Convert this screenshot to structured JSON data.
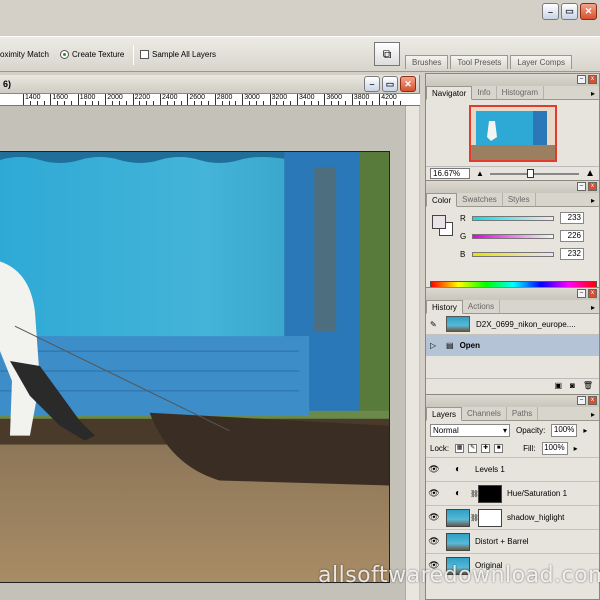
{
  "app": {
    "buttons": [
      "minimize",
      "maximize",
      "close"
    ]
  },
  "options_bar": {
    "proximity_match": "oximity Match",
    "create_texture": "Create Texture",
    "sample_all_layers": "Sample All Layers",
    "well_tabs": [
      "Brushes",
      "Tool Presets",
      "Layer Comps"
    ]
  },
  "document": {
    "title": "6)",
    "ruler": [
      "1400",
      "1600",
      "1800",
      "2000",
      "2200",
      "2400",
      "2600",
      "2800",
      "3000",
      "3200",
      "3400",
      "3600",
      "3800",
      "4200"
    ]
  },
  "navigator": {
    "tabs": [
      "Navigator",
      "Info",
      "Histogram"
    ],
    "zoom": "16.67%",
    "zoom_slider_level": 0.45
  },
  "color": {
    "tabs": [
      "Color",
      "Swatches",
      "Styles"
    ],
    "channels": [
      {
        "label": "R",
        "value": "233"
      },
      {
        "label": "G",
        "value": "226"
      },
      {
        "label": "B",
        "value": "232"
      }
    ]
  },
  "history": {
    "tabs": [
      "History",
      "Actions"
    ],
    "snapshot": "D2X_0699_nikon_europe....",
    "steps": [
      "Open"
    ]
  },
  "layers": {
    "tabs": [
      "Layers",
      "Channels",
      "Paths"
    ],
    "blend_mode": "Normal",
    "opacity_label": "Opacity:",
    "opacity": "100%",
    "lock_label": "Lock:",
    "fill_label": "Fill:",
    "fill": "100%",
    "items": [
      {
        "name": "Levels 1",
        "kind": "adjustment"
      },
      {
        "name": "Hue/Saturation 1",
        "kind": "adjustment-mask"
      },
      {
        "name": "shadow_higlight",
        "kind": "image-mask"
      },
      {
        "name": "Distort + Barrel",
        "kind": "image"
      },
      {
        "name": "Original",
        "kind": "image"
      }
    ]
  },
  "watermark": "allsoftwaredownload.com"
}
